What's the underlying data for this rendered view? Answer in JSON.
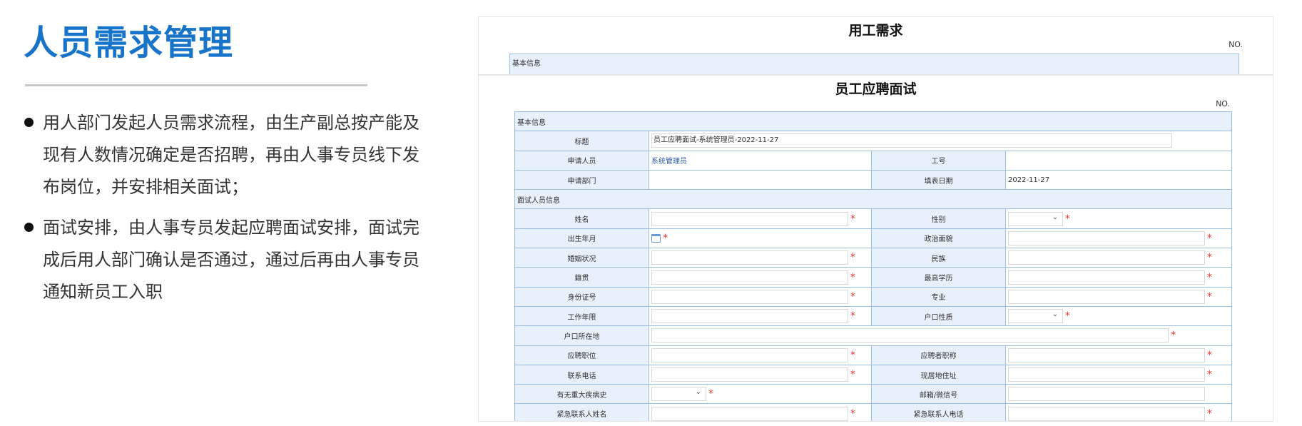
{
  "slide": {
    "title": "人员需求管理",
    "bullets": [
      "用人部门发起人员需求流程，由生产副总按产能及现有人数情况确定是否招聘，再由人事专员线下发布岗位，并安排相关面试；",
      "面试安排，由人事专员发起应聘面试安排，面试完成后用人部门确认是否通过，通过后再由人事专员通知新员工入职"
    ]
  },
  "back_form": {
    "title": "用工需求",
    "no_label": "NO.",
    "section": "基本信息"
  },
  "front_form": {
    "title": "员工应聘面试",
    "no_label": "NO.",
    "section_basic": "基本信息",
    "section_interviewee": "面试人员信息",
    "subject_label": "标题",
    "subject_value": "员工应聘面试-系统管理员-2022-11-27",
    "applicant_label": "申请人员",
    "applicant_value": "系统管理员",
    "employee_no_label": "工号",
    "dept_label": "申请部门",
    "fill_date_label": "填表日期",
    "fill_date_value": "2022-11-27",
    "name_label": "姓名",
    "gender_label": "性别",
    "birth_label": "出生年月",
    "political_label": "政治面貌",
    "marital_label": "婚姻状况",
    "ethnicity_label": "民族",
    "native_label": "籍贯",
    "education_label": "最高学历",
    "id_label": "身份证号",
    "major_label": "专业",
    "work_years_label": "工作年限",
    "hukou_type_label": "户口性质",
    "hukou_place_label": "户口所在地",
    "position_label": "应聘职位",
    "title_label": "应聘者职称",
    "phone_label": "联系电话",
    "address_label": "现居地住址",
    "disease_label": "有无重大疾病史",
    "email_label": "邮箱/微信号",
    "emergency_name_label": "紧急联系人姓名",
    "emergency_phone_label": "紧急联系人电话",
    "required_mark": "*"
  }
}
